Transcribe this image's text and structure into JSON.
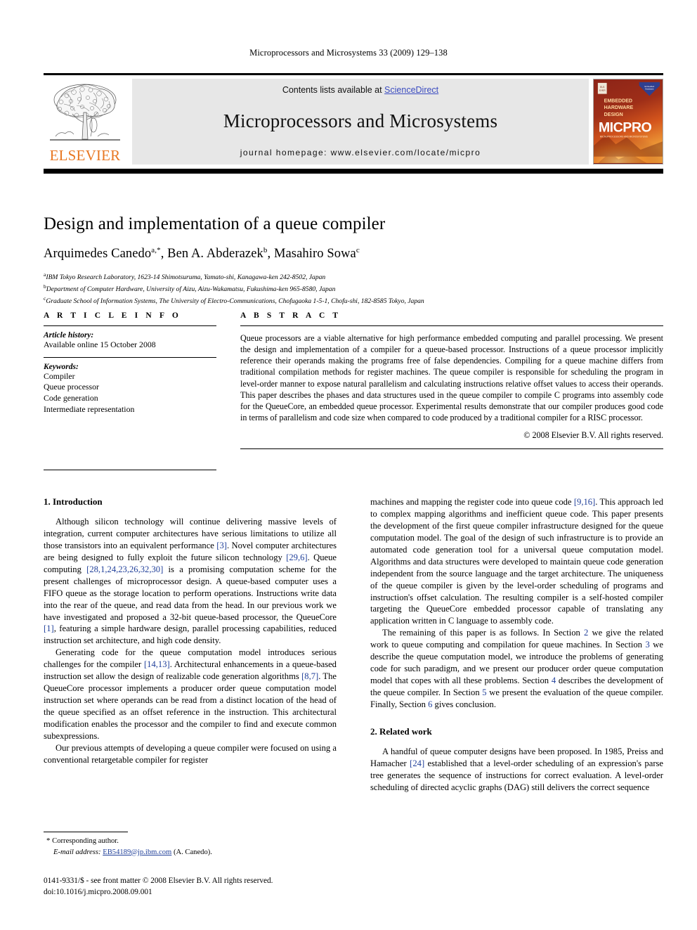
{
  "running_head": "Microprocessors and Microsystems 33 (2009) 129–138",
  "journal_header": {
    "contents_prefix": "Contents lists available at ",
    "sciencedirect": "ScienceDirect",
    "journal_title": "Microprocessors and Microsystems",
    "homepage": "journal homepage: www.elsevier.com/locate/micpro",
    "publisher_logo_text": "ELSEVIER",
    "cover": {
      "line1": "EMBEDDED",
      "line2": "HARDWARE",
      "line3": "DESIGN",
      "brand": "MICPRO",
      "subtitle": "MICROPROCESSORS AND MICROSYSTEMS",
      "corner_badge": "Embedded Hardware Design"
    },
    "link_color": "#3b4cc0",
    "elsevier_orange": "#E87722"
  },
  "article": {
    "title": "Design and implementation of a queue compiler",
    "authors": [
      {
        "name": "Arquimedes Canedo",
        "marks": "a,*"
      },
      {
        "name": "Ben A. Abderazek",
        "marks": "b"
      },
      {
        "name": "Masahiro Sowa",
        "marks": "c"
      }
    ],
    "authors_line": "Arquimedes Canedo a,*, Ben A. Abderazek b, Masahiro Sowa c",
    "affiliations": [
      {
        "mark": "a",
        "text": "IBM Tokyo Research Laboratory, 1623-14 Shimotsuruma, Yamato-shi, Kanagawa-ken 242-8502, Japan"
      },
      {
        "mark": "b",
        "text": "Department of Computer Hardware, University of Aizu, Aizu-Wakamatsu, Fukushima-ken 965-8580, Japan"
      },
      {
        "mark": "c",
        "text": "Graduate School of Information Systems, The University of Electro-Communications, Chofugaoka 1-5-1, Chofu-shi, 182-8585 Tokyo, Japan"
      }
    ]
  },
  "article_info": {
    "heading": "A R T I C L E    I N F O",
    "history_label": "Article history:",
    "history_value": "Available online 15 October 2008",
    "keywords_label": "Keywords:",
    "keywords": [
      "Compiler",
      "Queue processor",
      "Code generation",
      "Intermediate representation"
    ]
  },
  "abstract": {
    "heading": "A B S T R A C T",
    "text": "Queue processors are a viable alternative for high performance embedded computing and parallel processing. We present the design and implementation of a compiler for a queue-based processor. Instructions of a queue processor implicitly reference their operands making the programs free of false dependencies. Compiling for a queue machine differs from traditional compilation methods for register machines. The queue compiler is responsible for scheduling the program in level-order manner to expose natural parallelism and calculating instructions relative offset values to access their operands. This paper describes the phases and data structures used in the queue compiler to compile C programs into assembly code for the QueueCore, an embedded queue processor. Experimental results demonstrate that our compiler produces good code in terms of parallelism and code size when compared to code produced by a traditional compiler for a RISC processor.",
    "copyright": "© 2008 Elsevier B.V. All rights reserved."
  },
  "body": {
    "section1_heading": "1. Introduction",
    "section2_heading": "2. Related work",
    "left_paragraphs": [
      "Although silicon technology will continue delivering massive levels of integration, current computer architectures have serious limitations to utilize all those transistors into an equivalent performance [3]. Novel computer architectures are being designed to fully exploit the future silicon technology [29,6]. Queue computing [28,1,24,23,26,32,30] is a promising computation scheme for the present challenges of microprocessor design. A queue-based computer uses a FIFO queue as the storage location to perform operations. Instructions write data into the rear of the queue, and read data from the head. In our previous work we have investigated and proposed a 32-bit queue-based processor, the QueueCore [1], featuring a simple hardware design, parallel processing capabilities, reduced instruction set architecture, and high code density.",
      "Generating code for the queue computation model introduces serious challenges for the compiler [14,13]. Architectural enhancements in a queue-based instruction set allow the design of realizable code generation algorithms [8,7]. The QueueCore processor implements a producer order queue computation model instruction set where operands can be read from a distinct location of the head of the queue specified as an offset reference in the instruction. This architectural modification enables the processor and the compiler to find and execute common subexpressions.",
      "Our previous attempts of developing a queue compiler were focused on using a conventional retargetable compiler for register"
    ],
    "right_paragraphs": [
      "machines and mapping the register code into queue code [9,16]. This approach led to complex mapping algorithms and inefficient queue code. This paper presents the development of the first queue compiler infrastructure designed for the queue computation model. The goal of the design of such infrastructure is to provide an automated code generation tool for a universal queue computation model. Algorithms and data structures were developed to maintain queue code generation independent from the source language and the target architecture. The uniqueness of the queue compiler is given by the level-order scheduling of programs and instruction's offset calculation. The resulting compiler is a self-hosted compiler targeting the QueueCore embedded processor capable of translating any application written in C language to assembly code.",
      "The remaining of this paper is as follows. In Section 2 we give the related work to queue computing and compilation for queue machines. In Section 3 we describe the queue computation model, we introduce the problems of generating code for such paradigm, and we present our producer order queue computation model that copes with all these problems. Section 4 describes the development of the queue compiler. In Section 5 we present the evaluation of the queue compiler. Finally, Section 6 gives conclusion."
    ],
    "related_work_paragraph": "A handful of queue computer designs have been proposed. In 1985, Preiss and Hamacher [24] established that a level-order scheduling of an expression's parse tree generates the sequence of instructions for correct evaluation. A level-order scheduling of directed acyclic graphs (DAG) still delivers the correct sequence",
    "citation_color": "#21409a"
  },
  "footer": {
    "corresponding_marker": "*",
    "corresponding_label": "Corresponding author.",
    "email_label": "E-mail address:",
    "email": "EB54189@jp.ibm.com",
    "email_owner": "(A. Canedo).",
    "issn_line": "0141-9331/$ - see front matter © 2008 Elsevier B.V. All rights reserved.",
    "doi_line": "doi:10.1016/j.micpro.2008.09.001"
  }
}
